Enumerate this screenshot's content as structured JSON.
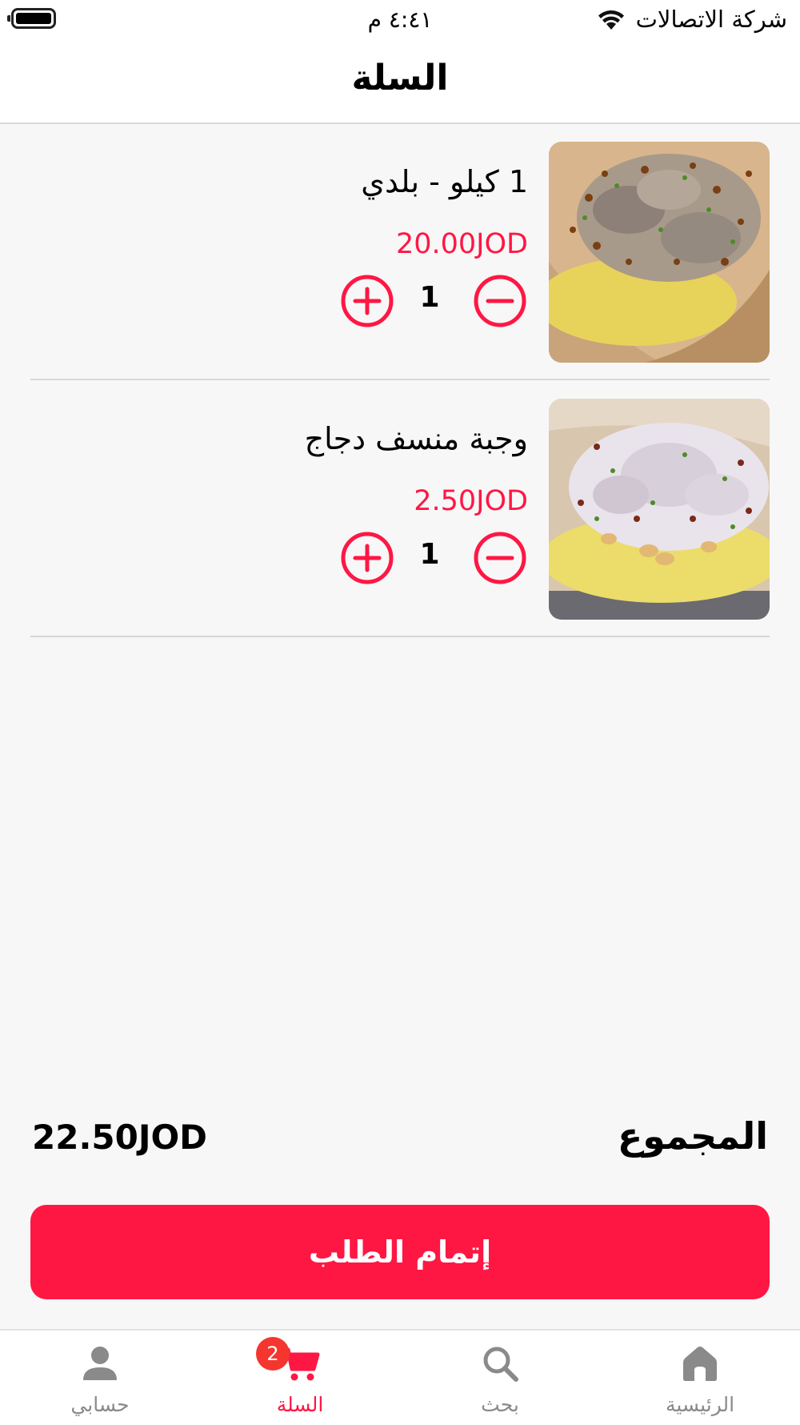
{
  "status_bar": {
    "time": "٤:٤١ م",
    "carrier": "شركة الاتصالات"
  },
  "header": {
    "title": "السلة"
  },
  "cart": {
    "items": [
      {
        "name": "1 كيلو - بلدي",
        "price": "20.00JOD",
        "quantity": "1",
        "image_icon": "mansaf-lamb-photo"
      },
      {
        "name": "وجبة منسف دجاج",
        "price": "2.50JOD",
        "quantity": "1",
        "image_icon": "mansaf-chicken-photo"
      }
    ]
  },
  "summary": {
    "total_label": "المجموع",
    "total_value": "22.50JOD"
  },
  "checkout": {
    "label": "إتمام الطلب"
  },
  "tab_bar": {
    "items": [
      {
        "label": "الرئيسية",
        "icon": "home-icon"
      },
      {
        "label": "بحث",
        "icon": "search-icon"
      },
      {
        "label": "السلة",
        "icon": "cart-icon",
        "badge": "2"
      },
      {
        "label": "حسابي",
        "icon": "user-icon"
      }
    ],
    "active": "السلة"
  },
  "colors": {
    "accent": "#ff1744",
    "inactive": "#8a8a8a",
    "badge": "#f4362e",
    "background": "#f7f7f7"
  }
}
